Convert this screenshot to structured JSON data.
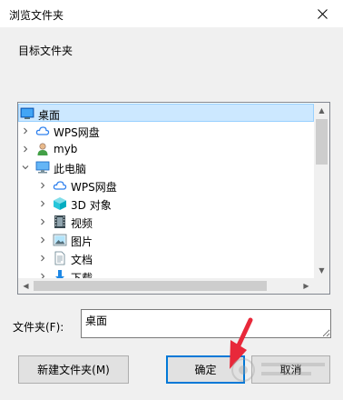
{
  "dialog": {
    "title": "浏览文件夹",
    "target_label": "目标文件夹"
  },
  "tree": {
    "items": [
      {
        "label": "桌面",
        "icon": "desktop-icon",
        "expander": ""
      },
      {
        "label": "WPS网盘",
        "icon": "cloud-icon",
        "expander": "›"
      },
      {
        "label": "myb",
        "icon": "user-icon",
        "expander": "›"
      },
      {
        "label": "此电脑",
        "icon": "computer-icon",
        "expander": "⌄"
      },
      {
        "label": "WPS网盘",
        "icon": "cloud-icon",
        "expander": "›"
      },
      {
        "label": "3D 对象",
        "icon": "cube-icon",
        "expander": "›"
      },
      {
        "label": "视频",
        "icon": "video-icon",
        "expander": "›"
      },
      {
        "label": "图片",
        "icon": "picture-icon",
        "expander": "›"
      },
      {
        "label": "文档",
        "icon": "document-icon",
        "expander": "›"
      },
      {
        "label": "下载",
        "icon": "download-icon",
        "expander": "›"
      }
    ],
    "selected_index": 0
  },
  "folder": {
    "label": "文件夹(F):",
    "value": "桌面"
  },
  "buttons": {
    "new_folder": "新建文件夹(M)",
    "ok": "确定",
    "cancel": "取消"
  },
  "colors": {
    "selection": "#cce8ff",
    "primary_border": "#0078d7",
    "annotation_arrow": "#e8283a"
  }
}
